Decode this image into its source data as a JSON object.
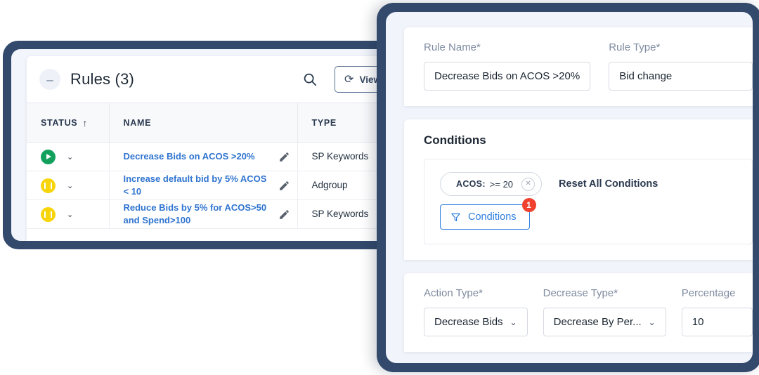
{
  "rules_window": {
    "header": {
      "collapse_glyph": "–",
      "title": "Rules (3)",
      "search_icon": "search-icon",
      "view_executions_label": "View Executio",
      "refresh_glyph": "⟳"
    },
    "table": {
      "columns": [
        {
          "label": "STATUS",
          "sort_arrow": "↑"
        },
        {
          "label": "NAME",
          "sort_arrow": ""
        },
        {
          "label": "TYPE",
          "sort_arrow": ""
        }
      ],
      "rows": [
        {
          "status": "running",
          "name": "Decrease Bids on ACOS >20%",
          "type": "SP Keywords"
        },
        {
          "status": "paused",
          "name": "Increase default bid by 5% ACOS < 10",
          "type": "Adgroup"
        },
        {
          "status": "paused",
          "name": "Reduce Bids by 5% for ACOS>50 and Spend>100",
          "type": "SP Keywords"
        }
      ]
    }
  },
  "editor_panel": {
    "basic": {
      "rule_name_label": "Rule Name*",
      "rule_name_value": "Decrease Bids on ACOS >20%",
      "rule_type_label": "Rule Type*",
      "rule_type_value": "Bid change"
    },
    "conditions": {
      "title": "Conditions",
      "chip": {
        "key": "ACOS:",
        "value": ">= 20",
        "remove_glyph": "✕"
      },
      "reset_label": "Reset All Conditions",
      "button_label": "Conditions",
      "button_icon": "funnel-icon",
      "badge_count": "1"
    },
    "action": {
      "action_type_label": "Action Type*",
      "action_type_value": "Decrease Bids",
      "decrease_type_label": "Decrease Type*",
      "decrease_type_value": "Decrease By Per...",
      "percentage_label": "Percentage",
      "percentage_value": "10",
      "caret_glyph": "⌄"
    }
  },
  "colors": {
    "frame_navy": "#334a6c",
    "panel_bg": "#f1f4fb",
    "link_blue": "#2f74d0",
    "accent_blue": "#2f7fe0",
    "status_running_green": "#12a05c",
    "status_paused_yellow": "#f7d50a",
    "badge_red": "#f0402f"
  }
}
